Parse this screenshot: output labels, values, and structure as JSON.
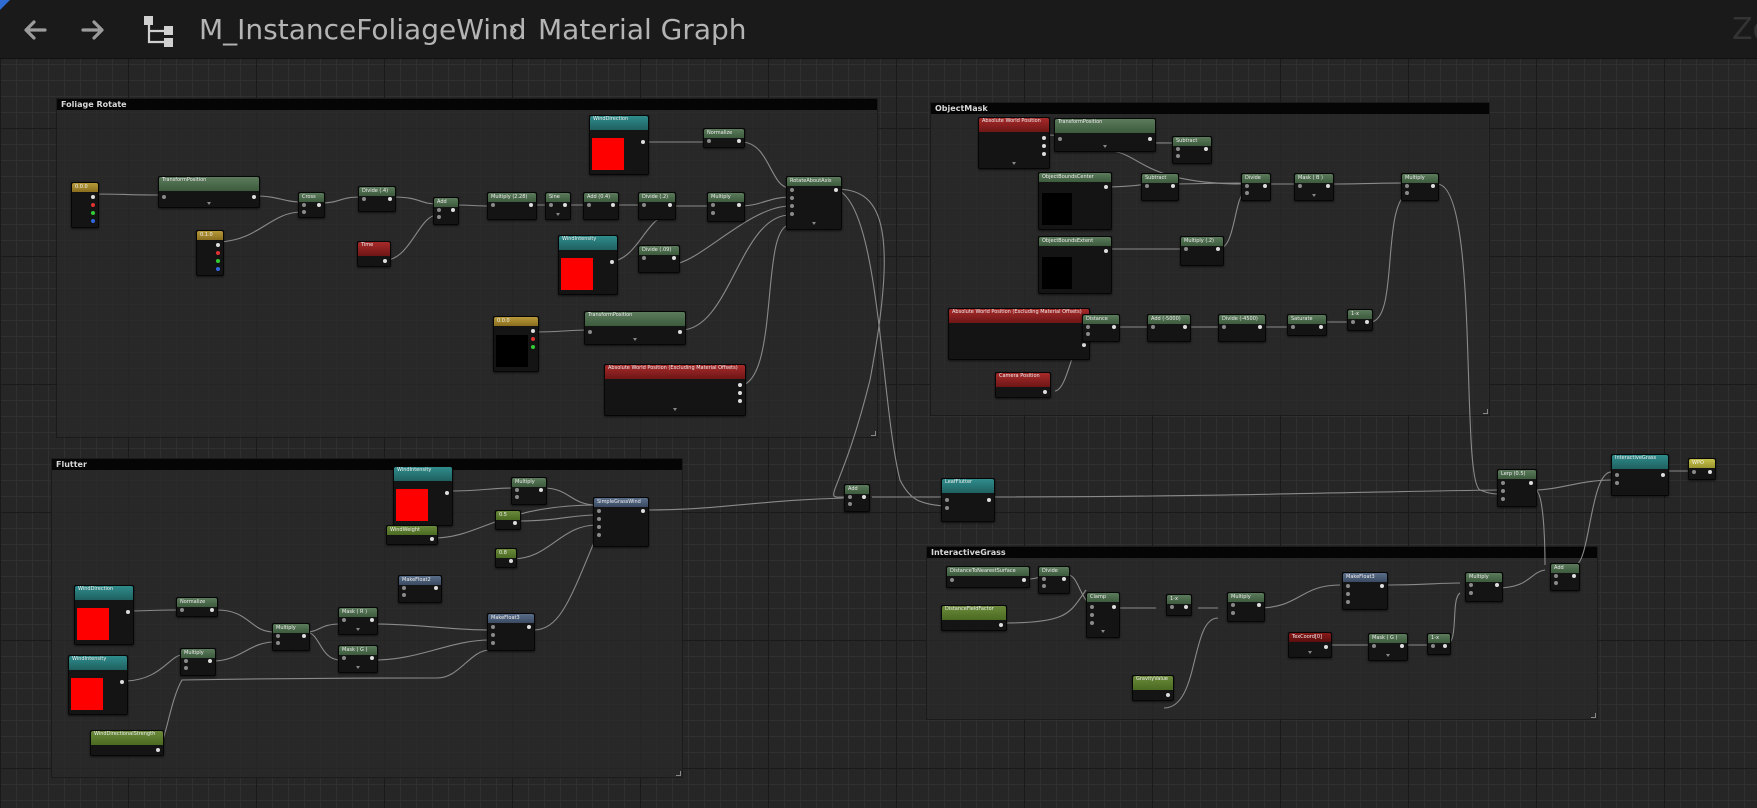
{
  "toolbar": {
    "back_label": "back",
    "forward_label": "forward",
    "asset_name": "M_InstanceFoliageWind",
    "graph_name": "Material Graph",
    "zoom_text": "Zo"
  },
  "comments": {
    "foliage_rotate": "Foliage Rotate",
    "object_mask": "ObjectMask",
    "flutter": "Flutter",
    "interactive_grass": "InteractiveGrass"
  },
  "nodes": {
    "fr_const_a": "0.0.0",
    "fr_transform_a": "TransformPosition",
    "fr_const_b": "0.1.0",
    "fr_wind_dir": "WindDirection",
    "fr_normalize": "Normalize",
    "fr_wind_int": "WindIntensity",
    "fr_cross": "Cross",
    "fr_divide": "Divide (.4)",
    "fr_time": "Time",
    "fr_add": "Add",
    "fr_multiply": "Multiply (2.28)",
    "fr_sine": "Sine",
    "fr_add2": "Add (0.4)",
    "fr_divide2": "Divide (.2)",
    "fr_divide3": "Divide (.09)",
    "fr_multiply2": "Multiply",
    "fr_rotate": "RotateAboutAxis",
    "fr_const_c": "0.0.0",
    "fr_transform_b": "TransformPosition",
    "fr_abs_world": "Absolute World Position (Excluding Material Offsets)",
    "om_abs_world": "Absolute World Position",
    "om_transform": "TransformPosition",
    "om_subtract": "Subtract",
    "om_bounds_center": "ObjectBoundsCenter",
    "om_subtract2": "Subtract",
    "om_bounds_extent": "ObjectBoundsExtent",
    "om_multiply": "Multiply (.2)",
    "om_divide": "Divide",
    "om_mask": "Mask ( B )",
    "om_multiply2": "Multiply",
    "om_abs_world2": "Absolute World Position (Excluding Material Offsets)",
    "om_distance": "Distance",
    "om_add": "Add (-5000)",
    "om_divide2": "Divide (-4500)",
    "om_saturate": "Saturate",
    "om_one_minus": "1-x",
    "om_camera": "Camera Position",
    "fl_wind_int": "WindIntensity",
    "fl_multiply": "Multiply",
    "fl_wind_dir": "WindDirection",
    "fl_const_a": "0.5",
    "fl_const_b": "0.8",
    "fl_simple_grass": "SimpleGrassWind",
    "fl_wind_weight": "WindWeight",
    "fl_makefloat2": "MakeFloat2",
    "fl_wind_dir2": "WindDirection",
    "fl_normalize": "Normalize",
    "fl_multiply2": "Multiply",
    "fl_mask_r": "Mask ( R )",
    "fl_mask_g": "Mask ( G )",
    "fl_makefloat3": "MakeFloat3",
    "fl_wind_int2": "WindIntensity",
    "fl_multiply3": "Multiply",
    "fl_wind_strength": "WindDirectionalStrength",
    "mid_add": "Add",
    "mid_leaf_flutter": "LeafFlutter",
    "ig_distance_field": "DistanceToNearestSurface",
    "ig_divide": "Divide",
    "ig_field_factor": "DistanceFieldFactor",
    "ig_clamp": "Clamp",
    "ig_one_minus": "1-x",
    "ig_multiply": "Multiply",
    "ig_makefloat3": "MakeFloat3",
    "ig_multiply2": "Multiply",
    "ig_texcoord": "TexCoord[0]",
    "ig_mask_g": "Mask ( G )",
    "ig_one_minus2": "1-x",
    "ig_gravity": "GravityValue",
    "rt_lerp": "Lerp (0.5)",
    "rt_add": "Add",
    "rt_interactive": "InteractiveGrass",
    "rt_wpo": "WPO"
  }
}
